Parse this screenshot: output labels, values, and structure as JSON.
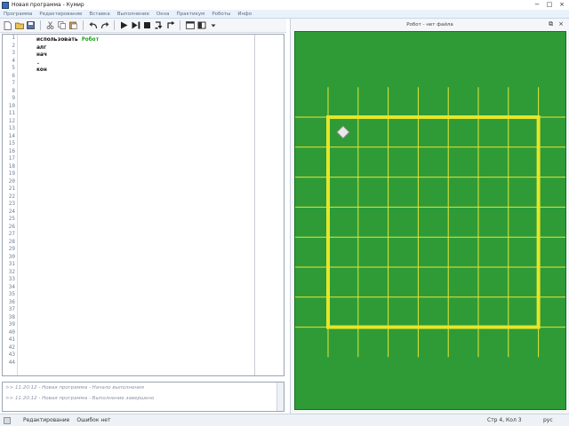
{
  "window": {
    "title": "Новая программа - Кумир",
    "controls": {
      "minimize": "−",
      "maximize": "□",
      "close": "×"
    }
  },
  "menu": {
    "items": [
      "Программа",
      "Редактирование",
      "Вставка",
      "Выполнение",
      "Окна",
      "Практикум",
      "Роботы",
      "Инфо"
    ]
  },
  "toolbar": {
    "icons": [
      "new-file-icon",
      "open-folder-icon",
      "save-icon",
      "cut-icon",
      "copy-icon",
      "paste-icon",
      "undo-icon",
      "redo-icon",
      "run-icon",
      "step-run-icon",
      "stop-icon",
      "step-into-icon",
      "step-out-icon",
      "window-icon",
      "window-split-icon",
      "dropdown-icon"
    ]
  },
  "editor": {
    "line_count": 44,
    "code": [
      {
        "prefix": "использовать ",
        "keyword": "Робот"
      },
      {
        "prefix": "алг",
        "keyword": ""
      },
      {
        "prefix": "нач",
        "keyword": ""
      },
      {
        "prefix": ".",
        "keyword": ""
      },
      {
        "prefix": "кон",
        "keyword": ""
      }
    ],
    "colors": {
      "robot_keyword": "#0a9a0a",
      "line_numbers": "#6b7c94"
    }
  },
  "output": {
    "lines": [
      ">>  11:20:12  - Новая программа  - Начало выполнения",
      ">>  11:20:12  - Новая программа  - Выполнение завершено"
    ]
  },
  "status": {
    "mode": "Редактирование",
    "errors": "Ошибок нет",
    "position": "Стр 4, Кол 3",
    "language": "рус"
  },
  "robot": {
    "title": "Робот - нет файла",
    "controls": {
      "float": "⧉",
      "close": "×"
    },
    "field": {
      "cols": 7,
      "rows": 7,
      "wall_cols": 7,
      "wall_rows": 7,
      "robot_col": 0,
      "robot_row": 0,
      "colors": {
        "background": "#2e9b36",
        "grid": "#e6e63a",
        "wall": "#e6e62a",
        "robot": "#e8e8e8"
      }
    }
  }
}
